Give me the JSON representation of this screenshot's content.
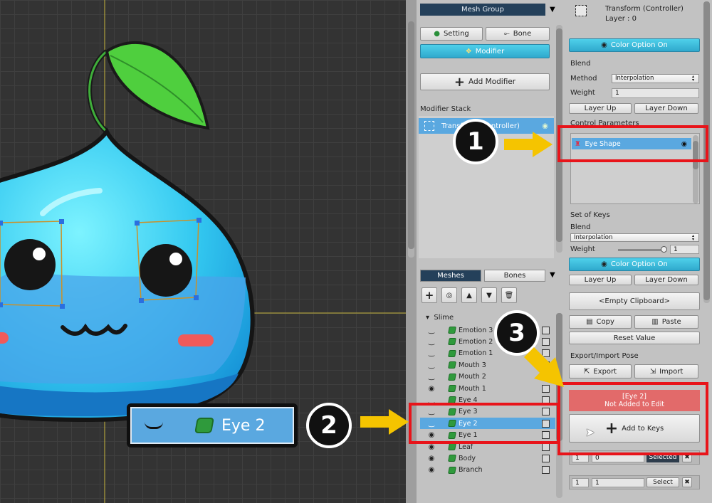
{
  "mesh_group_panel": {
    "title": "Mesh Group",
    "setting_label": "Setting",
    "bone_label": "Bone",
    "modifier_label": "Modifier",
    "add_modifier_label": "Add Modifier",
    "modifier_stack_label": "Modifier Stack",
    "stack_item_label": "Transform (Controller)"
  },
  "meshes_panel": {
    "tab_meshes": "Meshes",
    "tab_bones": "Bones",
    "root_label": "Slime",
    "rows": [
      {
        "name": "Emotion 3",
        "vis": "closed"
      },
      {
        "name": "Emotion 2",
        "vis": "closed"
      },
      {
        "name": "Emotion 1",
        "vis": "closed"
      },
      {
        "name": "Mouth 3",
        "vis": "closed"
      },
      {
        "name": "Mouth 2",
        "vis": "closed"
      },
      {
        "name": "Mouth 1",
        "vis": "open"
      },
      {
        "name": "Eye 4",
        "vis": "closed"
      },
      {
        "name": "Eye 3",
        "vis": "closed"
      },
      {
        "name": "Eye 2",
        "vis": "closed",
        "selected": true
      },
      {
        "name": "Eye 1",
        "vis": "open"
      },
      {
        "name": "Leaf",
        "vis": "open"
      },
      {
        "name": "Body",
        "vis": "open"
      },
      {
        "name": "Branch",
        "vis": "open"
      }
    ]
  },
  "controller_panel": {
    "title": "Transform (Controller)",
    "layer": "Layer : 0",
    "color_option_label": "Color Option On",
    "blend_label": "Blend",
    "method_label": "Method",
    "method_value": "Interpolation",
    "weight_label": "Weight",
    "weight_value": "1",
    "layer_up": "Layer Up",
    "layer_down": "Layer Down",
    "control_params_label": "Control Parameters",
    "param_item": "Eye Shape",
    "set_of_keys_label": "Set of Keys",
    "blend2_label": "Blend",
    "blend2_value": "Interpolation",
    "weight2_label": "Weight",
    "weight2_value": "1",
    "color_option2_label": "Color Option On",
    "layer_up2": "Layer Up",
    "layer_down2": "Layer Down",
    "clipboard_label": "<Empty Clipboard>",
    "copy_label": "Copy",
    "paste_label": "Paste",
    "reset_label": "Reset Value",
    "export_import_label": "Export/Import Pose",
    "export_label": "Export",
    "import_label": "Import",
    "status_line1": "[Eye 2]",
    "status_line2": "Not Added to Edit",
    "add_to_keys_label": "Add to Keys",
    "key_row1": {
      "index": "1",
      "value": "0",
      "action": "Selected"
    },
    "key_row2": {
      "index": "1",
      "value": "1",
      "action": "Select"
    }
  },
  "callouts": {
    "one": "1",
    "two": "2",
    "three": "3",
    "zoom_label": "Eye 2"
  },
  "colors": {
    "accent_cyan": "#3bbedf",
    "highlight_red": "#e8141a",
    "arrow_yellow": "#f5c400",
    "status_red": "#e26a6a",
    "selection_blue": "#5aa8e0"
  }
}
